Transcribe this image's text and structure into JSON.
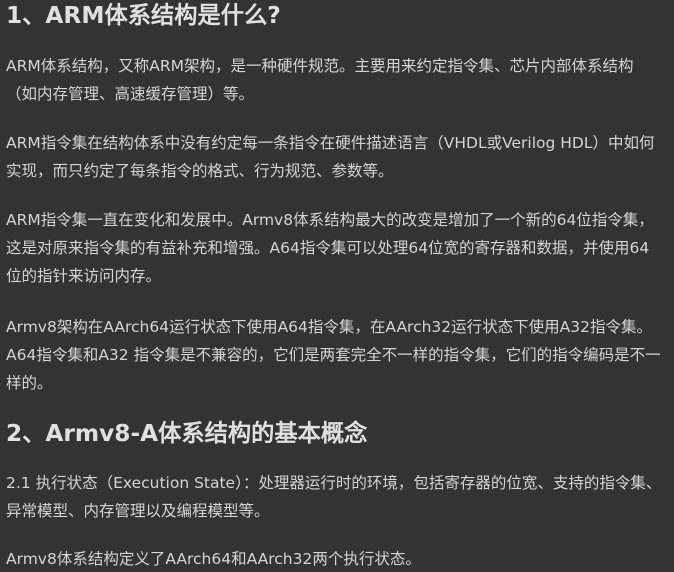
{
  "sections": [
    {
      "heading": "1、ARM体系结构是什么?",
      "paragraphs": [
        "ARM体系结构，又称ARM架构，是一种硬件规范。主要用来约定指令集、芯片内部体系结构（如内存管理、高速缓存管理）等。",
        "ARM指令集在结构体系中没有约定每一条指令在硬件描述语言（VHDL或Verilog HDL）中如何实现，而只约定了每条指令的格式、行为规范、参数等。",
        "ARM指令集一直在变化和发展中。Armv8体系结构最大的改变是增加了一个新的64位指令集，这是对原来指令集的有益补充和增强。A64指令集可以处理64位宽的寄存器和数据，并使用64位的指针来访问内存。",
        "Armv8架构在AArch64运行状态下使用A64指令集，在AArch32运行状态下使用A32指令集。A64指令集和A32 指令集是不兼容的，它们是两套完全不一样的指令集，它们的指令编码是不一样的。"
      ]
    },
    {
      "heading": "2、Armv8-A体系结构的基本概念",
      "paragraphs": [
        "2.1 执行状态（Execution State）：处理器运行时的环境，包括寄存器的位宽、支持的指令集、异常模型、内存管理以及编程模型等。",
        "Armv8体系结构定义了AArch64和AArch32两个执行状态。"
      ]
    }
  ]
}
